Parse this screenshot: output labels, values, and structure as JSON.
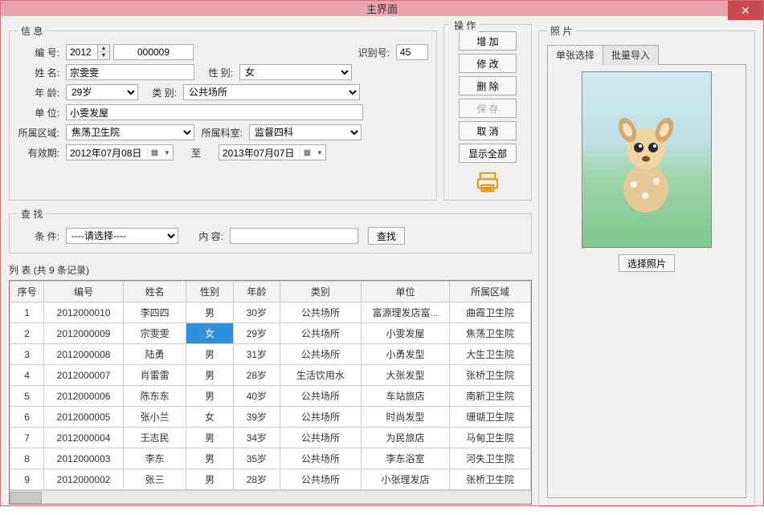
{
  "window": {
    "title": "主界面"
  },
  "info": {
    "legend": "信 息",
    "labels": {
      "bianhao": "编 号:",
      "shibiehao": "识别号:",
      "xingming": "姓 名:",
      "xingbie": "性 别:",
      "nianling": "年 龄:",
      "leibie": "类 别:",
      "danwei": "单 位:",
      "quyu": "所属区域:",
      "keshi": "所属科室:",
      "youxiaoqi": "有效期:",
      "zhi": "至"
    },
    "values": {
      "year": "2012",
      "seq": "000009",
      "shibiehao": "45",
      "xingming": "宗雯雯",
      "xingbie": "女",
      "nianling": "29岁",
      "leibie": "公共场所",
      "danwei": "小雯发屋",
      "quyu": "焦荡卫生院",
      "keshi": "监督四科",
      "date_from": "2012年07月08日",
      "date_to": "2013年07月07日"
    }
  },
  "search": {
    "legend": "查 找",
    "labels": {
      "tiaojian": "条 件:",
      "neirong": "内 容:"
    },
    "tiaojian_value": "----请选择----",
    "neirong_value": "",
    "btn": "查找"
  },
  "ops": {
    "legend": "操 作",
    "add": "增 加",
    "edit": "修 改",
    "del": "删 除",
    "save": "保 存",
    "cancel": "取 消",
    "showall": "显示全部"
  },
  "photo": {
    "legend": "照 片",
    "tab1": "单张选择",
    "tab2": "批量导入",
    "select_btn": "选择照片"
  },
  "list": {
    "title": "列 表 (共 9 条记录)",
    "headers": [
      "序号",
      "编号",
      "姓名",
      "性别",
      "年龄",
      "类别",
      "单位",
      "所属区域"
    ],
    "rows": [
      [
        "1",
        "2012000010",
        "李四四",
        "男",
        "30岁",
        "公共场所",
        "富源理发店富...",
        "曲霞卫生院"
      ],
      [
        "2",
        "2012000009",
        "宗雯雯",
        "女",
        "29岁",
        "公共场所",
        "小雯发屋",
        "焦荡卫生院"
      ],
      [
        "3",
        "2012000008",
        "陆勇",
        "男",
        "31岁",
        "公共场所",
        "小勇发型",
        "大生卫生院"
      ],
      [
        "4",
        "2012000007",
        "肖雷雷",
        "男",
        "28岁",
        "生活饮用水",
        "大张发型",
        "张桥卫生院"
      ],
      [
        "5",
        "2012000006",
        "陈东东",
        "男",
        "40岁",
        "公共场所",
        "车站旅店",
        "南新卫生院"
      ],
      [
        "6",
        "2012000005",
        "张小兰",
        "女",
        "39岁",
        "公共场所",
        "时尚发型",
        "珊瑚卫生院"
      ],
      [
        "7",
        "2012000004",
        "王志民",
        "男",
        "34岁",
        "公共场所",
        "为民旅店",
        "马甸卫生院"
      ],
      [
        "8",
        "2012000003",
        "李东",
        "男",
        "35岁",
        "公共场所",
        "李东浴室",
        "河失卫生院"
      ],
      [
        "9",
        "2012000002",
        "张三",
        "男",
        "28岁",
        "公共场所",
        "小张理发店",
        "张桥卫生院"
      ]
    ],
    "highlight_row": 1,
    "highlight_col": 3
  }
}
